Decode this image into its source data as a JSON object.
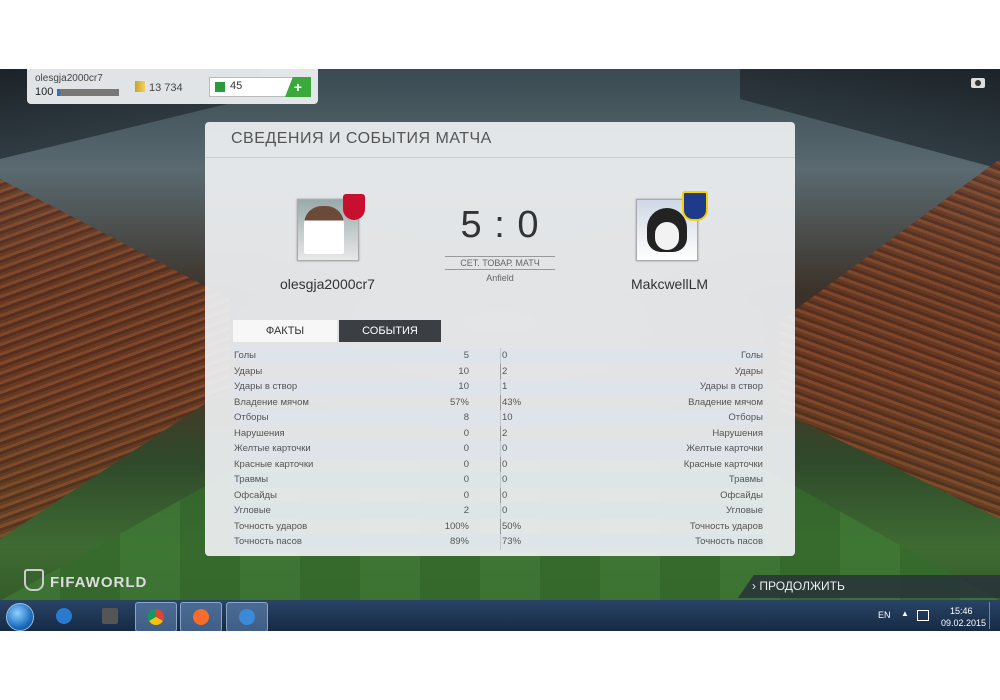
{
  "user": {
    "name": "olesgja2000cr7",
    "level": "100",
    "xp_progress": 0.05,
    "coins": "13 734",
    "points": "45",
    "add_points_label": "+"
  },
  "panel": {
    "title": "СВЕДЕНИЯ И СОБЫТИЯ МАТЧА"
  },
  "match": {
    "home_team": "olesgja2000cr7",
    "away_team": "MakcwellLM",
    "score": "5 : 0",
    "match_type": "СЕТ. ТОВАР. МАТЧ",
    "stadium": "Anfield"
  },
  "tabs": {
    "facts": "ФАКТЫ",
    "events": "СОБЫТИЯ"
  },
  "stats": [
    {
      "label": "Голы",
      "home": "5",
      "away": "0"
    },
    {
      "label": "Удары",
      "home": "10",
      "away": "2"
    },
    {
      "label": "Удары в створ",
      "home": "10",
      "away": "1"
    },
    {
      "label": "Владение мячом",
      "home": "57%",
      "away": "43%"
    },
    {
      "label": "Отборы",
      "home": "8",
      "away": "10"
    },
    {
      "label": "Нарушения",
      "home": "0",
      "away": "2"
    },
    {
      "label": "Желтые карточки",
      "home": "0",
      "away": "0"
    },
    {
      "label": "Красные карточки",
      "home": "0",
      "away": "0"
    },
    {
      "label": "Травмы",
      "home": "0",
      "away": "0"
    },
    {
      "label": "Офсайды",
      "home": "0",
      "away": "0"
    },
    {
      "label": "Угловые",
      "home": "2",
      "away": "0"
    },
    {
      "label": "Точность ударов",
      "home": "100%",
      "away": "50%"
    },
    {
      "label": "Точность пасов",
      "home": "89%",
      "away": "73%"
    }
  ],
  "footer": {
    "logo_text": "FIFAWORLD",
    "continue_label": "› ПРОДОЛЖИТЬ"
  },
  "taskbar": {
    "lang": "EN",
    "time": "15:46",
    "date": "09.02.2015"
  },
  "colors": {
    "accent_green": "#3aa83a",
    "dark_tab": "#3b3f44",
    "taskbar": "#1f3a5a"
  },
  "icons": [
    "windows-start-icon",
    "media-player-icon",
    "film-icon",
    "chrome-icon",
    "origin-icon",
    "fifaworld-icon",
    "camera-icon",
    "coin-icon",
    "points-icon"
  ]
}
